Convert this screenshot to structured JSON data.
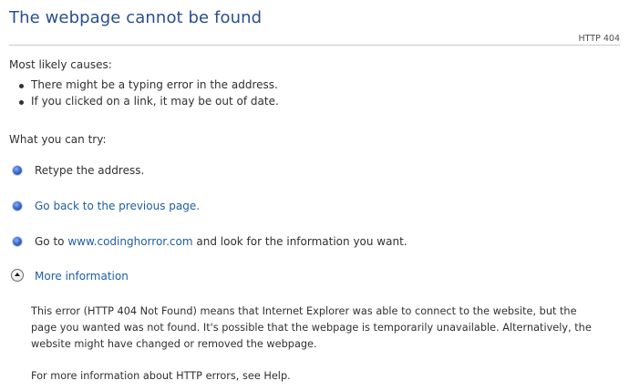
{
  "page": {
    "title": "The webpage cannot be found",
    "code": "HTTP 404"
  },
  "causes": {
    "heading": "Most likely causes:",
    "items": [
      "There might be a typing error in the address.",
      "If you clicked on a link, it may be out of date."
    ]
  },
  "try": {
    "heading": "What you can try:",
    "retype": "Retype the address.",
    "back_link": "Go back to the previous page.",
    "goto_prefix": "Go to ",
    "goto_link": "www.codinghorror.com",
    "goto_suffix": " and look for the information you want."
  },
  "more": {
    "label": "More information",
    "detail_lines": [
      "This error (HTTP 404 Not Found) means that Internet Explorer was able to connect to the website, but the",
      "page you wanted was not found. It's possible that the webpage is temporarily unavailable. Alternatively, the",
      "website might have changed or removed the webpage."
    ],
    "help_text": "For more information about HTTP errors, see Help."
  },
  "colors": {
    "title": "#2a4e90",
    "link": "#1e5ea8",
    "text": "#303030",
    "rule": "#c9c9c9"
  },
  "icons": {
    "bullet": "blue-dot-icon",
    "more": "chevron-up-circle-icon"
  }
}
